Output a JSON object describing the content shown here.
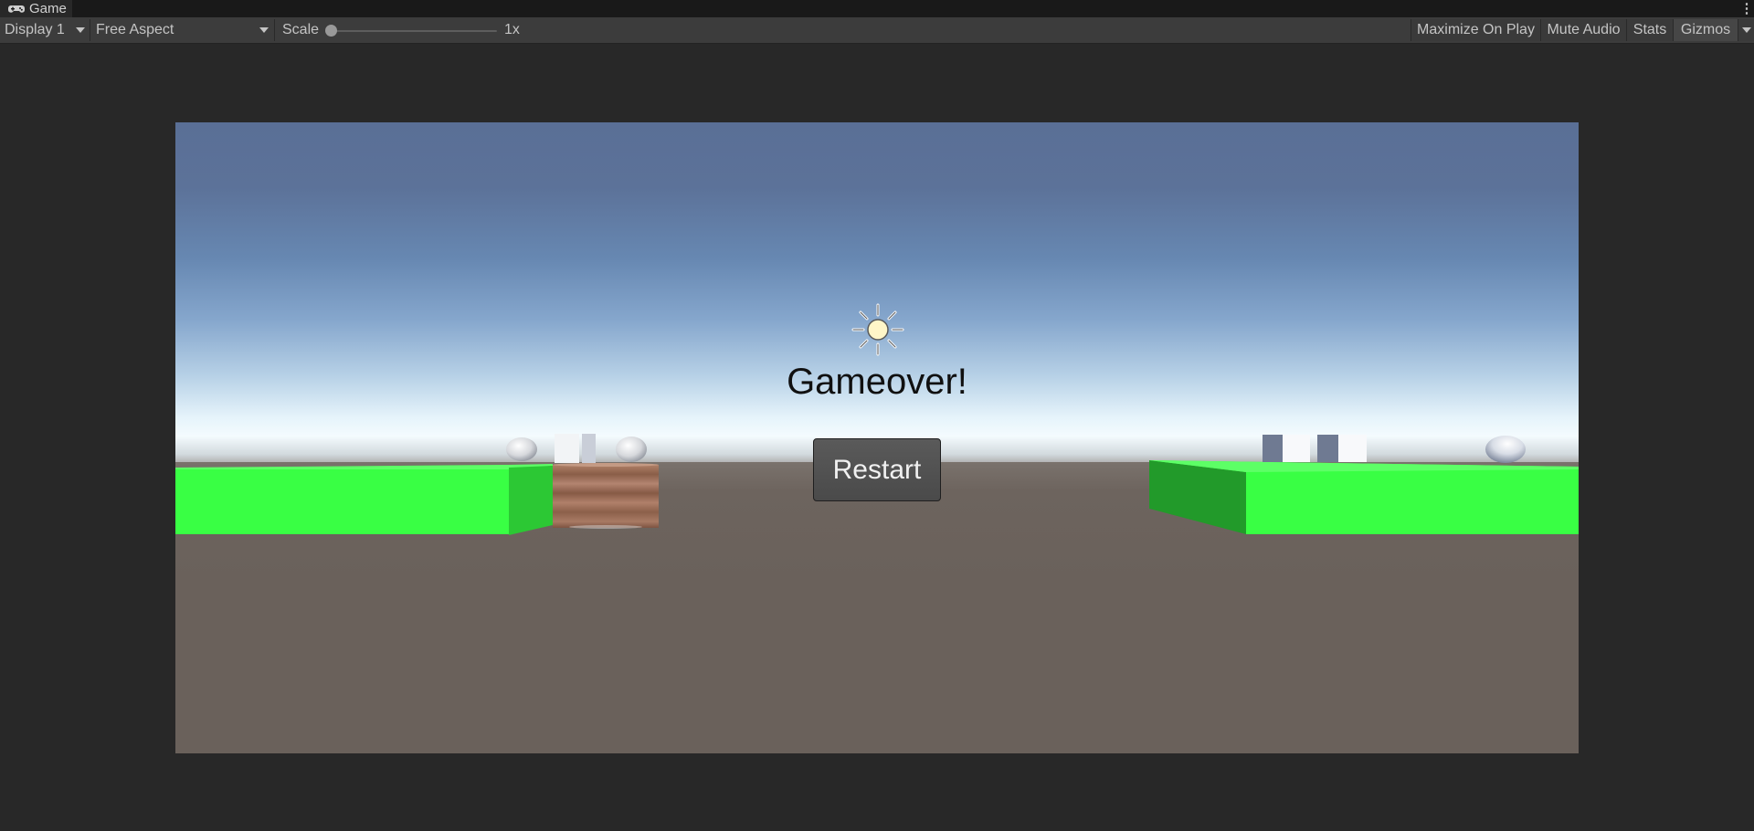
{
  "window": {
    "tab_title": "Game",
    "tab_icon": "gamepad-icon",
    "tab_menu_glyph": "⋮"
  },
  "toolbar": {
    "display_label": "Display 1",
    "aspect_label": "Free Aspect",
    "scale_label": "Scale",
    "scale_value_label": "1x",
    "scale_fraction": 0.0,
    "maximize_label": "Maximize On Play",
    "mute_label": "Mute Audio",
    "stats_label": "Stats",
    "gizmos_label": "Gizmos"
  },
  "game": {
    "title": "Gameover!",
    "restart_label": "Restart",
    "sun_icon": "sun-icon"
  },
  "colors": {
    "editor_bg": "#282828",
    "toolbar_bg": "#3c3c3c",
    "platform_green": "#39ff44",
    "ground": "#6a615b",
    "button_bg": "#4f4f4f"
  }
}
